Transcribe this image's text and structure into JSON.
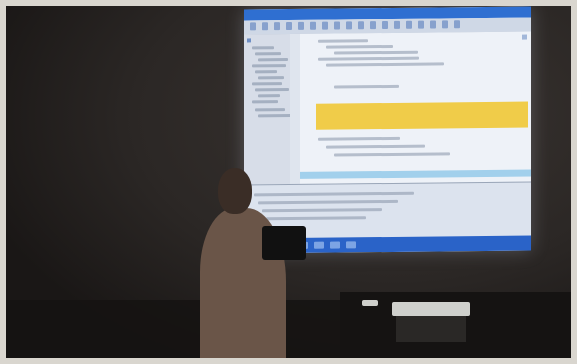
{
  "scene": {
    "colors": {
      "room_dark": "#2b2725",
      "room_shadow": "#1a1716",
      "photo_border": "#d9d6cf",
      "screen_bg": "#e6ecf5",
      "titlebar": "#2f6fd1",
      "toolbar": "#cfd8e6",
      "tool_glyph": "#6f8fc4",
      "side_panel": "#d7dde8",
      "tree_row": "#7c8aa0",
      "gutter": "#dfe5ee",
      "editor_bg": "#eef2f8",
      "code_line": "#8693a8",
      "highlight": "#f0c93a",
      "selection_band": "#8fc7e8",
      "bottom_panel": "#dce3ee",
      "taskbar": "#2a63c8",
      "task_glyph": "#9fc0f0",
      "presenter_head": "#3a2d26",
      "presenter_body": "#6a5548",
      "podium": "#111",
      "desk": "#151312",
      "device": "#cfd0cc",
      "device_base": "#2a2826"
    },
    "icons": [
      "code-editor-icon",
      "project-tree-icon",
      "taskbar-icon"
    ]
  }
}
